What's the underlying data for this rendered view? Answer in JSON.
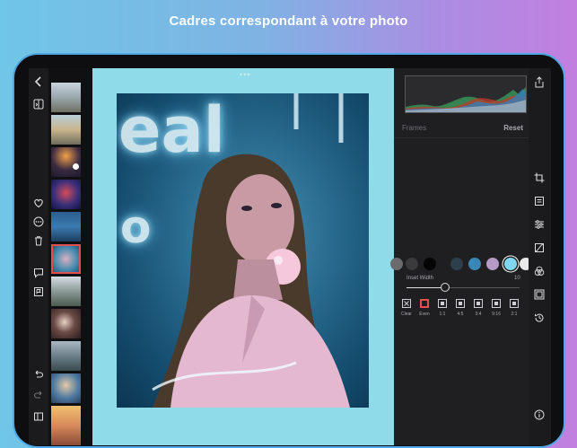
{
  "headline": "Cadres correspondant à votre photo",
  "canvas": {
    "more_dots": "•••"
  },
  "photo": {
    "neon_text_top": "eal",
    "neon_text_side": "o"
  },
  "panel": {
    "section_title": "Frames",
    "reset_label": "Reset",
    "inset_width_label": "Inset Width",
    "inset_width_value": "10",
    "inset_width_fraction": 0.34,
    "swatches": [
      "#6b6b6e",
      "#3a3a3d",
      "#050505",
      "#2c3f4a",
      "#3a86b6",
      "#b49ac4",
      "#7fd6ee",
      "#e8e8e8"
    ],
    "selected_swatch": "#7fd6ee",
    "frame_options": [
      {
        "label": "Clear",
        "icon": "clear-icon"
      },
      {
        "label": "Even",
        "icon": "frame-even-icon"
      },
      {
        "label": "1:1",
        "icon": "frame-1-1-icon"
      },
      {
        "label": "4:5",
        "icon": "frame-4-5-icon"
      },
      {
        "label": "3:4",
        "icon": "frame-3-4-icon"
      },
      {
        "label": "9:16",
        "icon": "frame-9-16-icon"
      },
      {
        "label": "2:1",
        "icon": "frame-2-1-icon"
      }
    ],
    "selected_frame": "Even"
  },
  "icons": {
    "left": [
      "back-chevron-icon",
      "compare-icon",
      "heart-icon",
      "more-icon",
      "trash-icon",
      "comment-icon",
      "flag-icon",
      "undo-icon",
      "redo-icon",
      "panel-toggle-icon"
    ],
    "right": [
      "share-icon",
      "crop-icon",
      "presets-icon",
      "adjust-icon",
      "curves-icon",
      "color-mix-icon",
      "frame-icon",
      "history-icon",
      "info-icon"
    ]
  },
  "accent_colors": {
    "selection": "#e05050",
    "canvas_bg": "#8fdbea"
  }
}
